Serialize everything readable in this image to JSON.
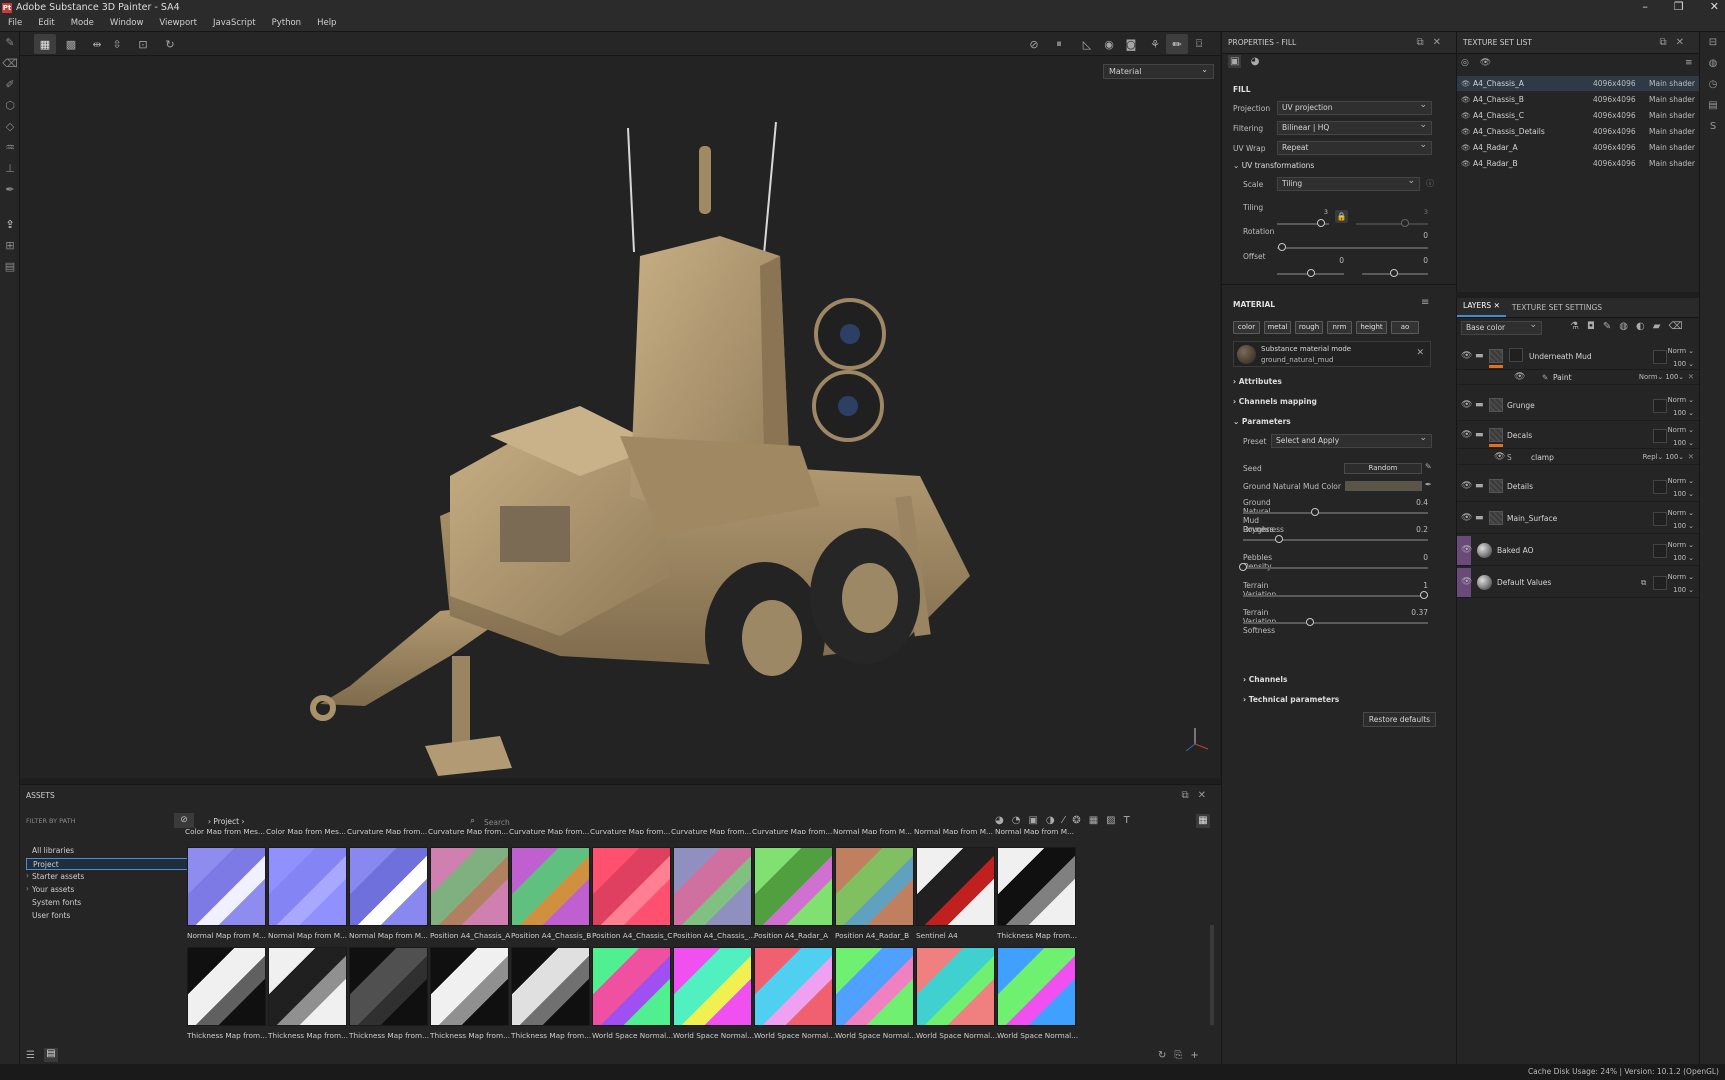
{
  "app": {
    "title": "Adobe Substance 3D Painter - SA4",
    "logo": "Pt"
  },
  "window_controls": [
    "–",
    "❐",
    "✕"
  ],
  "menu": [
    "File",
    "Edit",
    "Mode",
    "Window",
    "Viewport",
    "JavaScript",
    "Python",
    "Help"
  ],
  "viewport": {
    "material_mode": "Material"
  },
  "properties": {
    "title": "PROPERTIES - FILL",
    "fill_section": "FILL",
    "projection": {
      "label": "Projection",
      "value": "UV projection"
    },
    "filtering": {
      "label": "Filtering",
      "value": "Bilinear | HQ"
    },
    "uvwrap": {
      "label": "UV Wrap",
      "value": "Repeat"
    },
    "uvtrans": "UV transformations",
    "scale": {
      "label": "Scale",
      "value": "Tiling"
    },
    "tiling": {
      "label": "Tiling",
      "value1": "3",
      "value2": "3"
    },
    "rotation": {
      "label": "Rotation",
      "value": "0"
    },
    "offset": {
      "label": "Offset",
      "value1": "0",
      "value2": "0"
    },
    "material_section": "MATERIAL",
    "channels": [
      "color",
      "metal",
      "rough",
      "nrm",
      "height",
      "ao"
    ],
    "substance_mode": "Substance material mode",
    "substance_name": "ground_natural_mud",
    "attributes": "Attributes",
    "channels_mapping": "Channels mapping",
    "parameters": "Parameters",
    "preset": {
      "label": "Preset",
      "value": "Select and Apply"
    },
    "seed": {
      "label": "Seed",
      "value": "Random"
    },
    "mud_color": {
      "label": "Ground Natural Mud Color",
      "color": "#5d5448"
    },
    "sliders": [
      {
        "label": "Ground Natural Mud Roughness",
        "value": "0.4",
        "pos": 0.4
      },
      {
        "label": "Dryness",
        "value": "0.2",
        "pos": 0.2
      },
      {
        "label": "Pebbles Density",
        "value": "0",
        "pos": 0
      },
      {
        "label": "Terrain Variation",
        "value": "1",
        "pos": 1
      },
      {
        "label": "Terrain Variation Softness",
        "value": "0.37",
        "pos": 0.37
      }
    ],
    "channels_fold": "Channels",
    "technical": "Technical parameters",
    "restore": "Restore defaults"
  },
  "texture_sets": {
    "title": "TEXTURE SET LIST",
    "rows": [
      {
        "name": "A4_Chassis_A",
        "res": "4096x4096",
        "shader": "Main shader"
      },
      {
        "name": "A4_Chassis_B",
        "res": "4096x4096",
        "shader": "Main shader"
      },
      {
        "name": "A4_Chassis_C",
        "res": "4096x4096",
        "shader": "Main shader"
      },
      {
        "name": "A4_Chassis_Details",
        "res": "4096x4096",
        "shader": "Main shader"
      },
      {
        "name": "A4_Radar_A",
        "res": "4096x4096",
        "shader": "Main shader"
      },
      {
        "name": "A4_Radar_B",
        "res": "4096x4096",
        "shader": "Main shader"
      }
    ]
  },
  "layers": {
    "tab1": "LAYERS",
    "tab2": "TEXTURE SET SETTINGS",
    "channel": "Base color",
    "rows": [
      {
        "name": "Underneath Mud",
        "blend": "Norm",
        "opacity": "100"
      },
      {
        "name": "Paint",
        "blend": "Norm",
        "opacity": "100"
      },
      {
        "name": "Grunge",
        "blend": "Norm",
        "opacity": "100"
      },
      {
        "name": "Decals",
        "blend": "Norm",
        "opacity": "100"
      },
      {
        "name": "clamp",
        "blend": "Repl",
        "opacity": "100"
      },
      {
        "name": "Details",
        "blend": "Norm",
        "opacity": "100"
      },
      {
        "name": "Main_Surface",
        "blend": "Norm",
        "opacity": "100"
      },
      {
        "name": "Baked AO",
        "blend": "Norm",
        "opacity": "100"
      },
      {
        "name": "Default Values",
        "blend": "Norm",
        "opacity": "100"
      }
    ]
  },
  "assets": {
    "title": "ASSETS",
    "filter": "FILTER BY PATH",
    "nav": [
      "All libraries",
      "Project",
      "Starter assets",
      "Your assets",
      "System fonts",
      "User fonts"
    ],
    "breadcrumb": "Project",
    "search": "Search",
    "top_captions": [
      "Color Map from Mes...",
      "Color Map from Mes...",
      "Curvature Map from...",
      "Curvature Map from...",
      "Curvature Map from...",
      "Curvature Map from...",
      "Curvature Map from...",
      "Curvature Map from...",
      "Normal Map from M...",
      "Normal Map from M...",
      "Normal Map from M..."
    ],
    "row1": [
      "Normal Map from M...",
      "Normal Map from M...",
      "Normal Map from M...",
      "Position A4_Chassis_A",
      "Position A4_Chassis_B",
      "Position A4_Chassis_C",
      "Position A4_Chassis_...",
      "Position A4_Radar_A",
      "Position A4_Radar_B",
      "Sentinel A4",
      "Thickness Map from..."
    ],
    "row2": [
      "Thickness Map from...",
      "Thickness Map from...",
      "Thickness Map from...",
      "Thickness Map from...",
      "Thickness Map from...",
      "World Space Normal...",
      "World Space Normal...",
      "World Space Normal...",
      "World Space Normal...",
      "World Space Normal...",
      "World Space Normal..."
    ]
  },
  "status": "Cache Disk Usage:   24% | Version: 10.1.2 (OpenGL)"
}
